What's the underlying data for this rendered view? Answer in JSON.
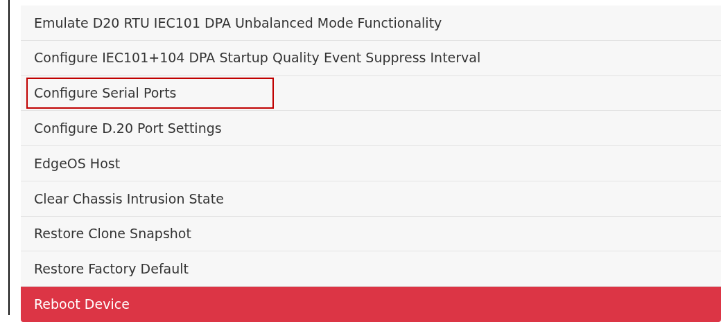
{
  "actions": [
    {
      "label": "Emulate D20 RTU IEC101 DPA Unbalanced Mode Functionality",
      "kind": "normal",
      "highlighted": false
    },
    {
      "label": "Configure IEC101+104 DPA Startup Quality Event Suppress Interval",
      "kind": "normal",
      "highlighted": false
    },
    {
      "label": "Configure Serial Ports",
      "kind": "normal",
      "highlighted": true
    },
    {
      "label": "Configure D.20 Port Settings",
      "kind": "normal",
      "highlighted": false
    },
    {
      "label": "EdgeOS Host",
      "kind": "normal",
      "highlighted": false
    },
    {
      "label": "Clear Chassis Intrusion State",
      "kind": "normal",
      "highlighted": false
    },
    {
      "label": "Restore Clone Snapshot",
      "kind": "normal",
      "highlighted": false
    },
    {
      "label": "Restore Factory Default",
      "kind": "normal",
      "highlighted": false
    },
    {
      "label": "Reboot Device",
      "kind": "danger",
      "highlighted": false
    }
  ]
}
